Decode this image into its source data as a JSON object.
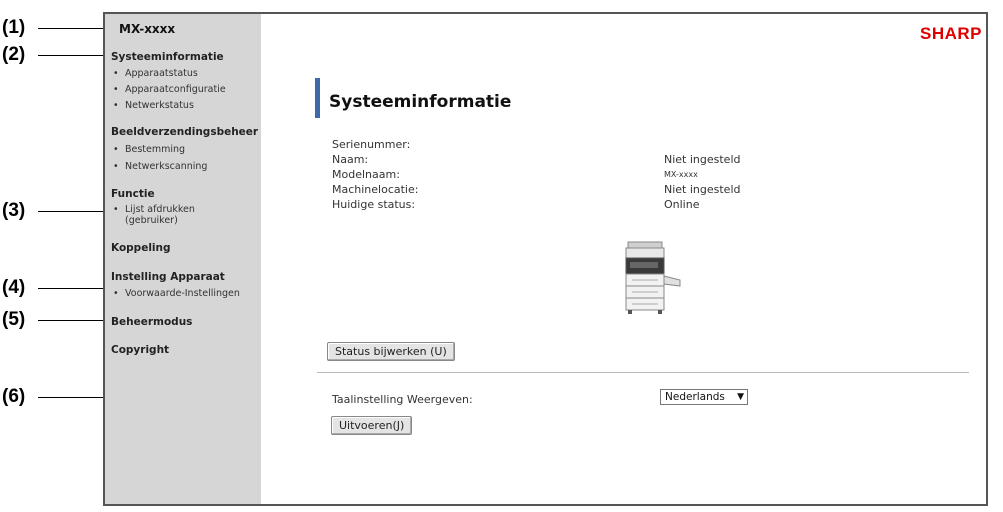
{
  "callouts": [
    "(1)",
    "(2)",
    "(3)",
    "(4)",
    "(5)",
    "(6)"
  ],
  "sidebar": {
    "model": "MX-xxxx",
    "sections": [
      {
        "title": "Systeeminformatie",
        "items": [
          "Apparaatstatus",
          "Apparaatconfiguratie",
          "Netwerkstatus"
        ]
      },
      {
        "title": "Beeldverzendingsbeheer",
        "items": [
          "Bestemming",
          "Netwerkscanning"
        ]
      },
      {
        "title": "Functie",
        "items": [
          "Lijst afdrukken (gebruiker)"
        ]
      },
      {
        "title": "Koppeling",
        "items": []
      },
      {
        "title": "Instelling Apparaat",
        "items": [
          "Voorwaarde-Instellingen"
        ]
      },
      {
        "title": "Beheermodus",
        "items": []
      },
      {
        "title": "Copyright",
        "items": []
      }
    ]
  },
  "header": {
    "brand": "SHARP"
  },
  "main": {
    "title": "Systeeminformatie",
    "fields": [
      {
        "label": "Serienummer:",
        "value": ""
      },
      {
        "label": "Naam:",
        "value": "Niet ingesteld"
      },
      {
        "label": "Modelnaam:",
        "value": "MX-xxxx"
      },
      {
        "label": "Machinelocatie:",
        "value": "Niet ingesteld"
      },
      {
        "label": "Huidige status:",
        "value": "Online"
      }
    ],
    "refresh_button": "Status bijwerken (U)",
    "language_label": "Taalinstelling Weergeven:",
    "language_selected": "Nederlands",
    "execute_button": "Uitvoeren(J)"
  },
  "colors": {
    "brand": "#dd0000",
    "accent": "#3d6aa8",
    "sidebar_bg": "#d6d6d6"
  }
}
